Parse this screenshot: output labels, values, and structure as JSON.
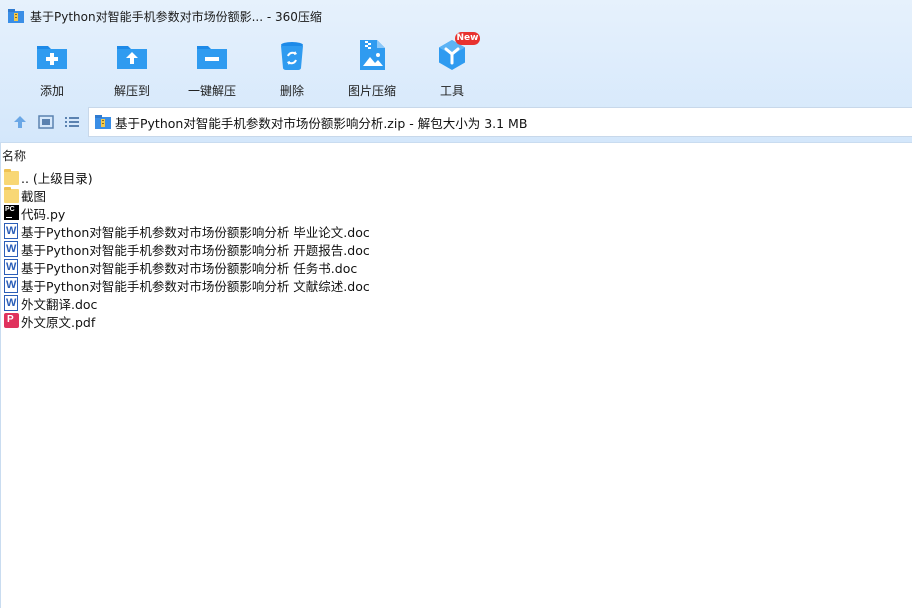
{
  "window": {
    "title": "基于Python对智能手机参数对市场份额影... - 360压缩"
  },
  "toolbar": {
    "items": [
      {
        "label": "添加",
        "icon": "add-icon"
      },
      {
        "label": "解压到",
        "icon": "extract-to-icon"
      },
      {
        "label": "一键解压",
        "icon": "one-click-extract-icon"
      },
      {
        "label": "删除",
        "icon": "delete-icon"
      },
      {
        "label": "图片压缩",
        "icon": "image-compress-icon"
      },
      {
        "label": "工具",
        "icon": "tools-icon"
      }
    ],
    "new_badge": "New"
  },
  "address_bar": {
    "text": "基于Python对智能手机参数对市场份额影响分析.zip - 解包大小为 3.1 MB"
  },
  "file_list": {
    "column_name": "名称",
    "items": [
      {
        "name": ".. (上级目录)",
        "type": "folder"
      },
      {
        "name": "截图",
        "type": "folder"
      },
      {
        "name": "代码.py",
        "type": "python"
      },
      {
        "name": "基于Python对智能手机参数对市场份额影响分析 毕业论文.doc",
        "type": "word"
      },
      {
        "name": "基于Python对智能手机参数对市场份额影响分析 开题报告.doc",
        "type": "word"
      },
      {
        "name": "基于Python对智能手机参数对市场份额影响分析 任务书.doc",
        "type": "word"
      },
      {
        "name": "基于Python对智能手机参数对市场份额影响分析 文献综述.doc",
        "type": "word"
      },
      {
        "name": "外文翻译.doc",
        "type": "word"
      },
      {
        "name": "外文原文.pdf",
        "type": "pdf"
      }
    ]
  },
  "colors": {
    "accent_blue": "#1e88e5",
    "badge_red": "#e8322f",
    "folder_yellow": "#f8d775"
  }
}
